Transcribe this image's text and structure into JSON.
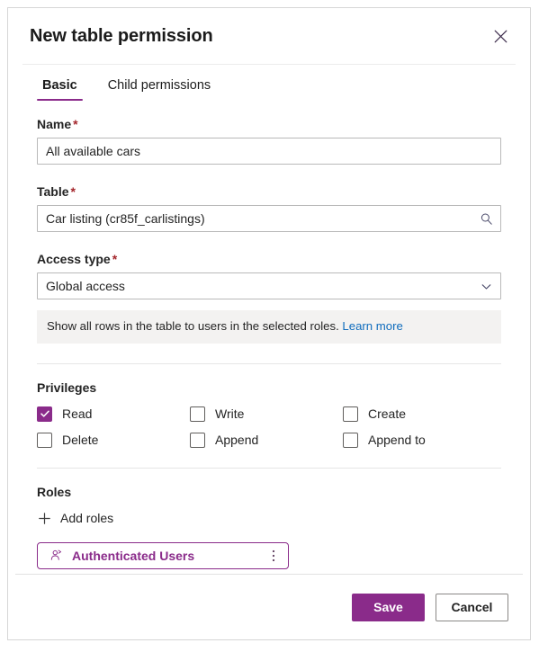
{
  "dialog": {
    "title": "New table permission",
    "close_icon": "close-icon"
  },
  "tabs": [
    {
      "label": "Basic",
      "active": true
    },
    {
      "label": "Child permissions",
      "active": false
    }
  ],
  "fields": {
    "name": {
      "label": "Name",
      "required": "*",
      "value": "All available cars",
      "placeholder": ""
    },
    "table": {
      "label": "Table",
      "required": "*",
      "value": "Car listing (cr85f_carlistings)",
      "placeholder": "",
      "icon": "search-icon"
    },
    "access_type": {
      "label": "Access type",
      "required": "*",
      "value": "Global access",
      "icon": "chevron-down-icon",
      "options": [
        "Global access"
      ]
    }
  },
  "info": {
    "text": "Show all rows in the table to users in the selected roles.",
    "link_label": "Learn more"
  },
  "privileges": {
    "title": "Privileges",
    "items": [
      {
        "label": "Read",
        "checked": true
      },
      {
        "label": "Write",
        "checked": false
      },
      {
        "label": "Create",
        "checked": false
      },
      {
        "label": "Delete",
        "checked": false
      },
      {
        "label": "Append",
        "checked": false
      },
      {
        "label": "Append to",
        "checked": false
      }
    ]
  },
  "roles": {
    "title": "Roles",
    "add_label": "Add roles",
    "add_icon": "plus-icon",
    "chips": [
      {
        "label": "Authenticated Users",
        "icon": "person-icon",
        "more_icon": "more-vertical-icon"
      }
    ]
  },
  "footer": {
    "save_label": "Save",
    "cancel_label": "Cancel"
  },
  "colors": {
    "accent": "#8a2b8a",
    "link": "#0f6cbd",
    "required": "#a4262c",
    "info_bg": "#f3f2f1"
  }
}
